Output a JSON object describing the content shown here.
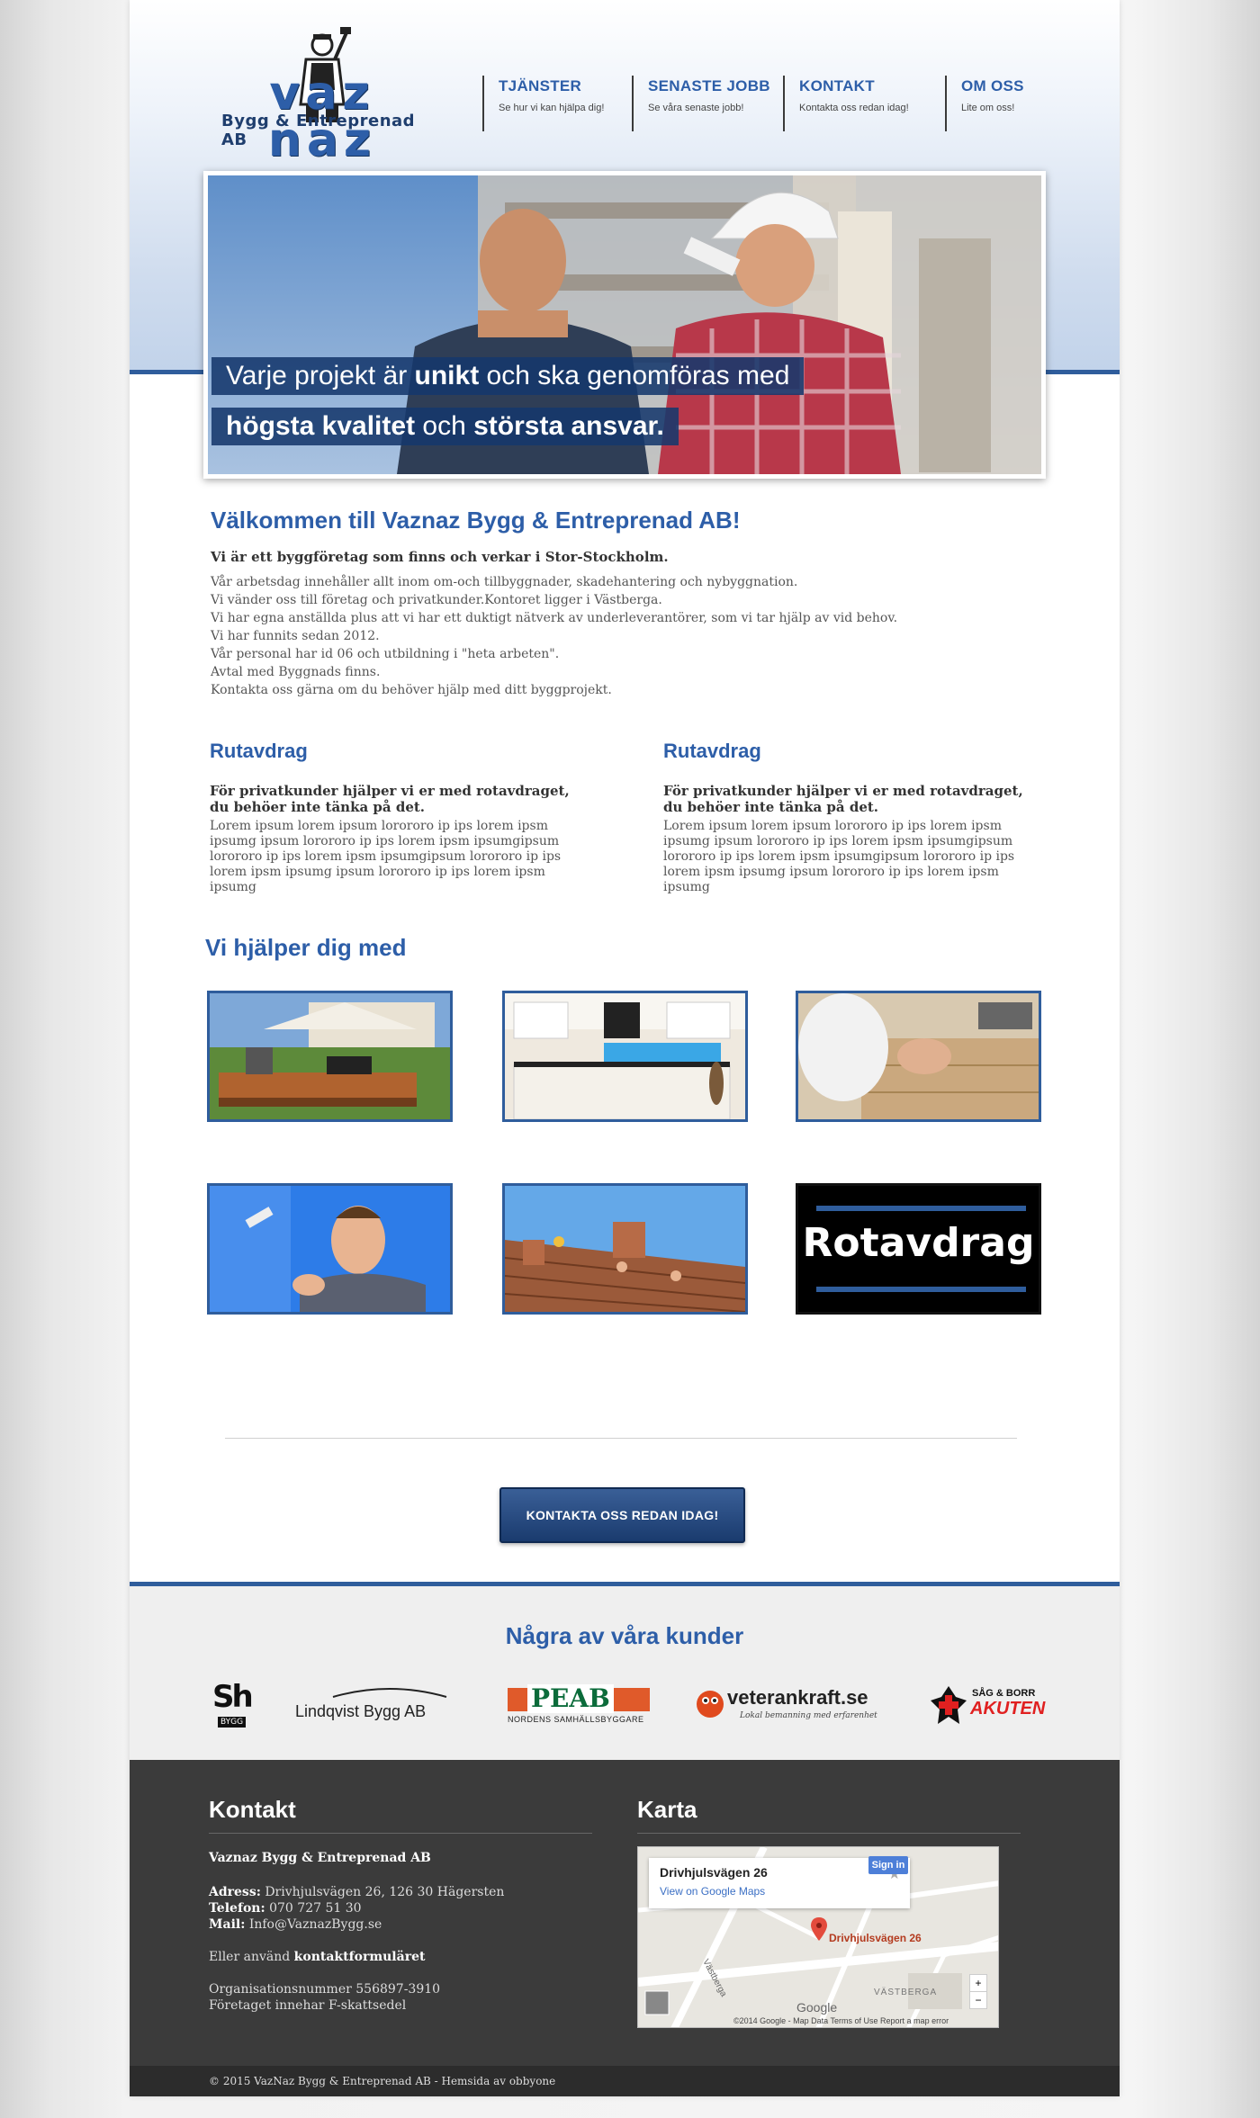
{
  "logo": {
    "main": "vaz naz",
    "subtitle": "Bygg & Entreprenad AB"
  },
  "nav": [
    {
      "title": "TJÄNSTER",
      "subtitle": "Se hur vi kan hjälpa dig!"
    },
    {
      "title": "SENASTE JOBB",
      "subtitle": "Se våra senaste jobb!"
    },
    {
      "title": "KONTAKT",
      "subtitle": "Kontakta oss redan idag!"
    },
    {
      "title": "OM OSS",
      "subtitle": "Lite om oss!"
    }
  ],
  "banner": {
    "line1_pre": "Varje projekt är ",
    "line1_bold": "unikt",
    "line1_post": " och ska genomföras med",
    "line2_bold1": "högsta kvalitet",
    "line2_mid": " och ",
    "line2_bold2": "största ansvar."
  },
  "welcome": {
    "title": "Välkommen till Vaznaz Bygg & Entreprenad AB!",
    "lead": "Vi är ett byggföretag som finns och verkar i Stor-Stockholm.",
    "lines": [
      "Vår arbetsdag innehåller allt inom om-och tillbyggnader, skadehantering och nybyggnation.",
      "Vi vänder oss till företag och privatkunder.Kontoret ligger i Västberga.",
      "Vi har egna anställda plus att vi har ett duktigt nätverk av underleverantörer, som vi tar hjälp av vid behov.",
      "Vi har funnits sedan 2012.",
      "Vår personal har id 06 och utbildning i \"heta arbeten\".",
      "Avtal med Byggnads finns.",
      "Kontakta oss gärna om du behöver hjälp med ditt byggprojekt."
    ]
  },
  "columns": [
    {
      "title": "Rutavdrag",
      "lead": "För privatkunder hjälper vi er med rotavdraget, du behöer inte tänka på det.",
      "body": "Lorem ipsum lorem ipsum lorororo ip ips lorem ipsm ipsumg ipsum lorororo ip ips lorem ipsm ipsumgipsum lorororo ip ips lorem ipsm ipsumgipsum lorororo ip ips lorem ipsm ipsumg ipsum lorororo ip ips lorem ipsm ipsumg"
    },
    {
      "title": "Rutavdrag",
      "lead": "För privatkunder hjälper vi er med rotavdraget, du behöer inte tänka på det.",
      "body": "Lorem ipsum lorem ipsum lorororo ip ips lorem ipsm ipsumg ipsum lorororo ip ips lorem ipsm ipsumgipsum lorororo ip ips lorem ipsm ipsumgipsum lorororo ip ips lorem ipsm ipsumg ipsum lorororo ip ips lorem ipsm ipsumg"
    }
  ],
  "services": {
    "title": "Vi hjälper dig med",
    "rot_label": "Rotavdrag"
  },
  "cta_label": "KONTAKTA OSS REDAN IDAG!",
  "clients": {
    "title": "Några av våra kunder",
    "items": [
      {
        "name": "Sh",
        "tag": "BYGG"
      },
      {
        "name": "Lindqvist Bygg AB"
      },
      {
        "name": "PEAB",
        "tag": "NORDENS SAMHÄLLSBYGGARE"
      },
      {
        "name": "veterankraft.se",
        "tag": "Lokal bemanning med erfarenhet"
      },
      {
        "name": "SÅG & BORR",
        "tag": "AKUTEN"
      }
    ]
  },
  "footer": {
    "contact_title": "Kontakt",
    "company": "Vaznaz Bygg & Entreprenad AB",
    "address_label": "Adress:",
    "address": "Drivhjulsvägen 26, 126 30 Hägersten",
    "phone_label": "Telefon:",
    "phone": "070 727 51 30",
    "mail_label": "Mail:",
    "mail": "Info@VaznazBygg.se",
    "form_pre": "Eller använd ",
    "form_link": "kontaktformuläret",
    "orgnr": "Organisationsnummer 556897-3910",
    "fskatt": "Företaget innehar F-skattsedel",
    "map_title": "Karta",
    "map": {
      "place": "Drivhjulsvägen 26",
      "view_link": "View on Google Maps",
      "signin": "Sign in",
      "pin_label": "Drivhjulsvägen 26",
      "area": "VÄSTBERGA",
      "street": "Västberga",
      "google": "Google",
      "footer": "©2014 Google - Map Data    Terms of Use    Report a map error"
    }
  },
  "copyright": "© 2015 VazNaz Bygg & Entreprenad AB - Hemsida av obbyone",
  "colors": {
    "brand_blue": "#2d5ea8",
    "dark_blue": "#1a3b6e",
    "footer_bg": "#3b3b3b"
  }
}
